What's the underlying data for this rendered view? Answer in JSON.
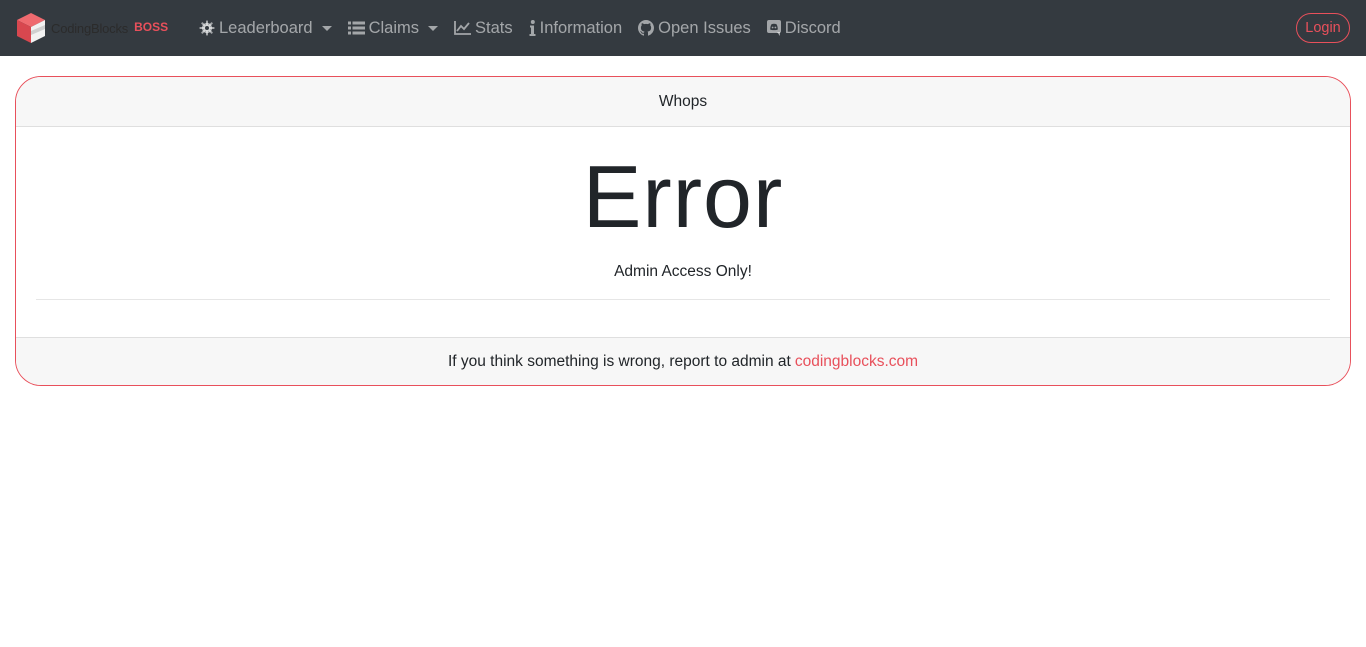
{
  "brand": {
    "name": "CodingBlocks",
    "tag": "BOSS"
  },
  "nav": {
    "items": [
      {
        "label": "Leaderboard",
        "icon": "gear-icon",
        "dropdown": true
      },
      {
        "label": "Claims",
        "icon": "list-icon",
        "dropdown": true
      },
      {
        "label": "Stats",
        "icon": "chart-line-icon",
        "dropdown": false
      },
      {
        "label": "Information",
        "icon": "info-icon",
        "dropdown": false
      },
      {
        "label": "Open Issues",
        "icon": "github-icon",
        "dropdown": false
      },
      {
        "label": "Discord",
        "icon": "discord-icon",
        "dropdown": false
      }
    ],
    "login_label": "Login"
  },
  "card": {
    "header": "Whops",
    "title": "Error",
    "message": "Admin Access Only!",
    "footer_text": "If you think something is wrong, report to admin at",
    "footer_link": "codingblocks.com"
  },
  "colors": {
    "navbar_bg": "#343a40",
    "accent": "#e8505b"
  }
}
